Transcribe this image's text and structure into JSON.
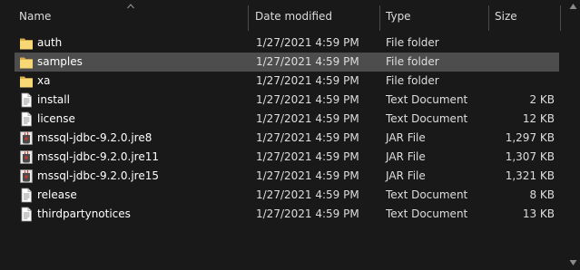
{
  "columns": {
    "name": "Name",
    "date_modified": "Date modified",
    "type": "Type",
    "size": "Size"
  },
  "sort": {
    "column": "name",
    "direction": "ascending"
  },
  "selected_index": 1,
  "colors": {
    "background": "#191919",
    "selected_row": "#4d4d4d",
    "folder": "#f8d775",
    "text": "#ffffff"
  },
  "files": [
    {
      "name": "auth",
      "date": "1/27/2021 4:59 PM",
      "type": "File folder",
      "size": "",
      "icon": "folder-icon"
    },
    {
      "name": "samples",
      "date": "1/27/2021 4:59 PM",
      "type": "File folder",
      "size": "",
      "icon": "folder-icon"
    },
    {
      "name": "xa",
      "date": "1/27/2021 4:59 PM",
      "type": "File folder",
      "size": "",
      "icon": "folder-icon"
    },
    {
      "name": "install",
      "date": "1/27/2021 4:59 PM",
      "type": "Text Document",
      "size": "2 KB",
      "icon": "text-document-icon"
    },
    {
      "name": "license",
      "date": "1/27/2021 4:59 PM",
      "type": "Text Document",
      "size": "12 KB",
      "icon": "text-document-icon"
    },
    {
      "name": "mssql-jdbc-9.2.0.jre8",
      "date": "1/27/2021 4:59 PM",
      "type": "JAR File",
      "size": "1,297 KB",
      "icon": "jar-file-icon"
    },
    {
      "name": "mssql-jdbc-9.2.0.jre11",
      "date": "1/27/2021 4:59 PM",
      "type": "JAR File",
      "size": "1,307 KB",
      "icon": "jar-file-icon"
    },
    {
      "name": "mssql-jdbc-9.2.0.jre15",
      "date": "1/27/2021 4:59 PM",
      "type": "JAR File",
      "size": "1,321 KB",
      "icon": "jar-file-icon"
    },
    {
      "name": "release",
      "date": "1/27/2021 4:59 PM",
      "type": "Text Document",
      "size": "8 KB",
      "icon": "text-document-icon"
    },
    {
      "name": "thirdpartynotices",
      "date": "1/27/2021 4:59 PM",
      "type": "Text Document",
      "size": "13 KB",
      "icon": "text-document-icon"
    }
  ]
}
